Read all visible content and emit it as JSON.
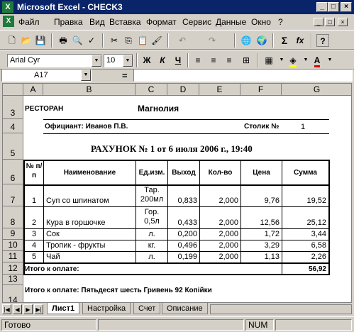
{
  "window": {
    "title": "Microsoft Excel - CHECK3",
    "app_icon": "excel-icon",
    "controls": [
      "_",
      "□",
      "×"
    ]
  },
  "menu": [
    "Файл",
    "Правка",
    "Вид",
    "Вставка",
    "Формат",
    "Сервис",
    "Данные",
    "Окно",
    "?"
  ],
  "mdi_controls": [
    "_",
    "□",
    "×"
  ],
  "standard_toolbar": {
    "icons": [
      "new-icon",
      "open-icon",
      "save-icon",
      "print-icon",
      "print-preview-icon",
      "spelling-icon",
      "cut-icon",
      "copy-icon",
      "paste-icon",
      "format-painter-icon",
      "undo-icon",
      "redo-icon",
      "hyperlink-icon",
      "web-icon",
      "autosum-icon",
      "function-icon",
      "help-icon"
    ],
    "autosum": "Σ",
    "function": "fx",
    "help": "?"
  },
  "format_toolbar": {
    "font": "Arial Cyr",
    "size": "10",
    "bold": "Ж",
    "italic": "К",
    "underline": "Ч"
  },
  "formula_bar": {
    "cell_ref": "A17",
    "equals": "=",
    "value": ""
  },
  "columns": [
    "A",
    "B",
    "C",
    "D",
    "E",
    "F",
    "G"
  ],
  "rows": [
    "3",
    "4",
    "5",
    "6",
    "7",
    "8",
    "9",
    "10",
    "11",
    "12",
    "13",
    "14"
  ],
  "sheet": {
    "r3_restaurant_label": "РЕСТОРАН",
    "r3_restaurant_name": "Магнолия",
    "r4_waiter": "Официант: Иванов П.В.",
    "r4_table_label": "Столик №",
    "r4_table_no": "1",
    "r5_receipt": "РАХУНОК № 1  от   6 июля 2006 г., 19:40",
    "headers": {
      "num": "№ п/п",
      "name": "Наименование",
      "unit": "Ед.изм.",
      "yield": "Выход",
      "qty": "Кол-во",
      "price": "Цена",
      "sum": "Сумма"
    },
    "items": [
      {
        "n": "1",
        "name": "Суп со шпинатом",
        "unit": "Тар. 200мл",
        "yield": "0,833",
        "qty": "2,000",
        "price": "9,76",
        "sum": "19,52"
      },
      {
        "n": "2",
        "name": "Кура в горшочке",
        "unit": "Гор. 0,5л",
        "yield": "0,433",
        "qty": "2,000",
        "price": "12,56",
        "sum": "25,12"
      },
      {
        "n": "3",
        "name": "Сок",
        "unit": "л.",
        "yield": "0,200",
        "qty": "2,000",
        "price": "1,72",
        "sum": "3,44"
      },
      {
        "n": "4",
        "name": "Тропик - фрукты",
        "unit": "кг.",
        "yield": "0,496",
        "qty": "2,000",
        "price": "3,29",
        "sum": "6,58"
      },
      {
        "n": "5",
        "name": "Чай",
        "unit": "л.",
        "yield": "0,199",
        "qty": "2,000",
        "price": "1,13",
        "sum": "2,26"
      }
    ],
    "r12_total_label": "Итого к оплате:",
    "r12_total": "56,92",
    "r14_total_words": "Итого к оплате: Пятьдесят шесть Гривень 92 Копійки"
  },
  "sheet_tabs": [
    "Лист1",
    "Настройка",
    "Счет",
    "Описание"
  ],
  "active_tab": "Лист1",
  "status": {
    "text": "Готово",
    "num": "NUM"
  }
}
